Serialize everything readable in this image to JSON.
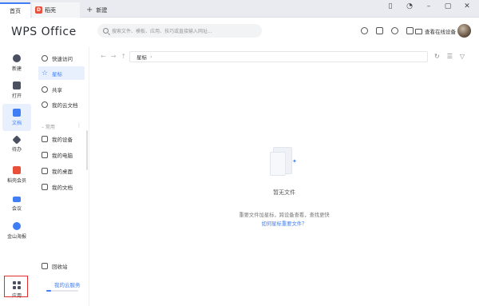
{
  "tabs": {
    "home": "首页",
    "store": "稻壳",
    "new": "新建"
  },
  "header": {
    "logo": "WPS Office",
    "search_placeholder": "搜索文件、模板、应用、技巧或直接输入网址...",
    "device_button": "查看在线设备"
  },
  "leftnav": {
    "items": [
      {
        "label": "新建",
        "icon": "plus-circle-icon"
      },
      {
        "label": "打开",
        "icon": "folder-icon"
      },
      {
        "label": "文档",
        "icon": "document-icon"
      },
      {
        "label": "待办",
        "icon": "todo-icon"
      },
      {
        "label": "稻壳会员",
        "icon": "docer-icon"
      },
      {
        "label": "会议",
        "icon": "meeting-icon"
      },
      {
        "label": "金山海报",
        "icon": "poster-icon"
      },
      {
        "label": "应用",
        "icon": "apps-icon"
      }
    ]
  },
  "sidecol": {
    "items": [
      {
        "label": "快速访问",
        "icon": "pin-icon"
      },
      {
        "label": "星标",
        "icon": "star-icon"
      },
      {
        "label": "共享",
        "icon": "share-icon"
      },
      {
        "label": "我的云文档",
        "icon": "cloud-icon"
      }
    ],
    "section_label": "常用",
    "common": [
      {
        "label": "我的设备",
        "icon": "device-icon"
      },
      {
        "label": "我的电脑",
        "icon": "computer-icon"
      },
      {
        "label": "我的桌面",
        "icon": "desktop-icon"
      },
      {
        "label": "我的文档",
        "icon": "docs-folder-icon"
      }
    ],
    "recycle": "回收站",
    "cloud_service": "我的云服务",
    "cloud_usage_fraction": 0.15
  },
  "main": {
    "path": "星标",
    "empty_title": "暂无文件",
    "empty_desc": "重要文件加星标，跨设备查看，查找更快",
    "empty_link": "如何星标重要文件？"
  },
  "colors": {
    "accent": "#3f7ef5",
    "highlight_box": "#e02b2b"
  }
}
